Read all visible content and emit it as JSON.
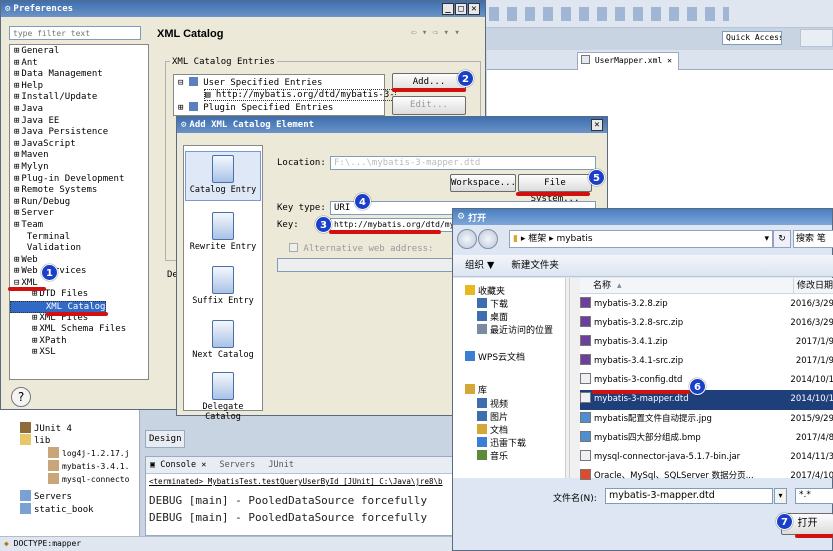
{
  "prefs": {
    "title": "Preferences",
    "filter_placeholder": "type filter text",
    "tree": [
      "General",
      "Ant",
      "Data Management",
      "Help",
      "Install/Update",
      "Java",
      "Java EE",
      "Java Persistence",
      "JavaScript",
      "Maven",
      "Mylyn",
      "Plug-in Development",
      "Remote Systems",
      "Run/Debug",
      "Server",
      "Team",
      "Terminal",
      "Validation",
      "Web",
      "Web Services",
      "XML",
      "DTD Files",
      "XML Catalog",
      "XML Files",
      "XML Schema Files",
      "XPath",
      "XSL"
    ],
    "page_title": "XML Catalog",
    "entries_label": "XML Catalog Entries",
    "entries": [
      "User Specified Entries",
      "http://mybatis.org/dtd/mybatis-3-",
      "Plugin Specified Entries"
    ],
    "add_label": "Add...",
    "edit_label": "Edit...",
    "de_label": "De"
  },
  "ide": {
    "quick_access": "Quick Access",
    "editor_tab": "UserMapper.xml",
    "design_tab": "Design",
    "console_tab": "Console",
    "servers_tab": "Servers",
    "junit_tab": "JUnit",
    "terminated": "<terminated> MybatisTest.testQueryUserById [JUnit] C:\\Java\\jre8\\b",
    "log1": "DEBUG [main] - PooledDataSource forcefully",
    "log2": "DEBUG [main] - PooledDataSource forcefully",
    "explorer": [
      "JUnit 4",
      "lib",
      "log4j-1.2.17.j",
      "mybatis-3.4.1.",
      "mysql-connecto",
      "Servers",
      "static_book"
    ],
    "status": "DOCTYPE:mapper"
  },
  "add_dialog": {
    "title": "Add XML Catalog Element",
    "sidebar": [
      "Catalog Entry",
      "Rewrite Entry",
      "Suffix Entry",
      "Next Catalog",
      "Delegate Catalog"
    ],
    "location_label": "Location:",
    "location_value": "F:\\...\\mybatis-3-mapper.dtd",
    "workspace_label": "Workspace...",
    "filesystem_label": "File System...",
    "keytype_label": "Key type:",
    "keytype_value": "URI",
    "key_label": "Key:",
    "key_value": "http://mybatis.org/dtd/my",
    "alt_label": "Alternative web address:"
  },
  "open_dialog": {
    "title": "打开",
    "breadcrumb_a": "框架",
    "breadcrumb_b": "mybatis",
    "search_label": "搜索 笔",
    "organize": "组织 ▼",
    "new_folder": "新建文件夹",
    "nav": [
      "收藏夹",
      "下载",
      "桌面",
      "最近访问的位置",
      "WPS云文档",
      "库",
      "视频",
      "图片",
      "文档",
      "迅雷下载",
      "音乐"
    ],
    "col_name": "名称",
    "col_date": "修改日期",
    "files": [
      {
        "name": "mybatis-3.2.8.zip",
        "date": "2016/3/29",
        "type": "zip"
      },
      {
        "name": "mybatis-3.2.8-src.zip",
        "date": "2016/3/29",
        "type": "zip"
      },
      {
        "name": "mybatis-3.4.1.zip",
        "date": "2017/1/9",
        "type": "zip"
      },
      {
        "name": "mybatis-3.4.1-src.zip",
        "date": "2017/1/9",
        "type": "zip"
      },
      {
        "name": "mybatis-3-config.dtd",
        "date": "2014/10/1",
        "type": "doc"
      },
      {
        "name": "mybatis-3-mapper.dtd",
        "date": "2014/10/1",
        "type": "doc"
      },
      {
        "name": "mybatis配置文件自动提示.jpg",
        "date": "2015/9/29",
        "type": "img"
      },
      {
        "name": "mybatis四大部分组成.bmp",
        "date": "2017/4/8",
        "type": "img"
      },
      {
        "name": "mysql-connector-java-5.1.7-bin.jar",
        "date": "2014/11/3",
        "type": "doc"
      },
      {
        "name": "Oracle、MySql、SQLServer 数据分页...",
        "date": "2017/4/10",
        "type": "web"
      }
    ],
    "filename_label": "文件名(N):",
    "filename_value": "mybatis-3-mapper.dtd",
    "filter_value": "*.*",
    "open_label": "打开"
  },
  "badges": [
    "1",
    "2",
    "3",
    "4",
    "5",
    "6",
    "7"
  ]
}
